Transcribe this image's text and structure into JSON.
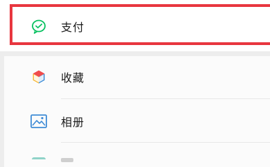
{
  "menu": {
    "pay": {
      "label": "支付",
      "icon": "wechat-pay-icon"
    },
    "favorites": {
      "label": "收藏",
      "icon": "favorites-cube-icon"
    },
    "album": {
      "label": "相册",
      "icon": "album-image-icon"
    }
  },
  "colors": {
    "pay_green": "#07c160",
    "highlight_red": "#e8363f",
    "album_blue": "#3f8cd6"
  }
}
